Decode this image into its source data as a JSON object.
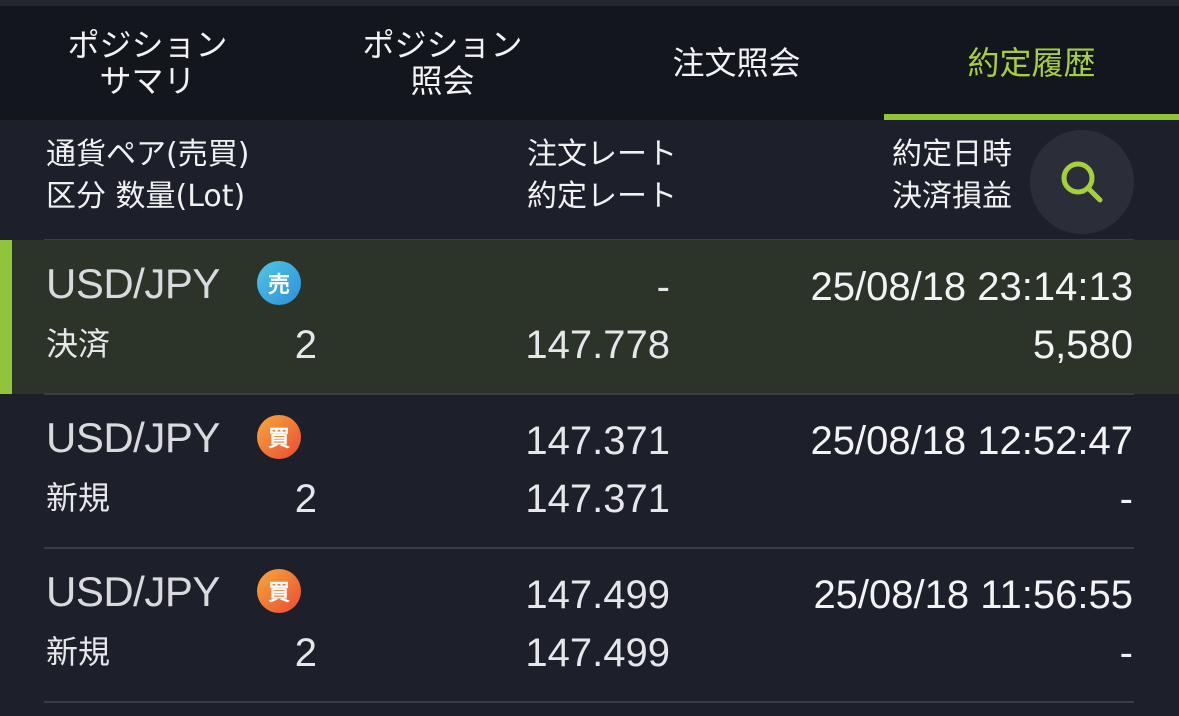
{
  "tabs": [
    {
      "label": "ポジション\nサマリ",
      "active": false
    },
    {
      "label": "ポジション\n照会",
      "active": false
    },
    {
      "label": "注文照会",
      "active": false
    },
    {
      "label": "約定履歴",
      "active": true
    }
  ],
  "header": {
    "col1_line1": "通貨ペア(売買)",
    "col1_line2": "区分  数量(Lot)",
    "col2_line1": "注文レート",
    "col2_line2": "約定レート",
    "col3_line1": "約定日時",
    "col3_line2": "決済損益",
    "search_icon": "search-icon"
  },
  "colors": {
    "accent": "#8fc43b",
    "active_tab": "#a5cf3d",
    "sell_badge": "#3aa8e0",
    "buy_badge": "#ef6b37",
    "background": "#1d202b"
  },
  "rows": [
    {
      "pair": "USD/JPY",
      "side": "売",
      "side_type": "sell",
      "category": "決済",
      "quantity": "2",
      "order_rate": "-",
      "exec_rate": "147.778",
      "datetime": "25/08/18 23:14:13",
      "pnl": "5,580",
      "selected": true
    },
    {
      "pair": "USD/JPY",
      "side": "買",
      "side_type": "buy",
      "category": "新規",
      "quantity": "2",
      "order_rate": "147.371",
      "exec_rate": "147.371",
      "datetime": "25/08/18 12:52:47",
      "pnl": "-",
      "selected": false
    },
    {
      "pair": "USD/JPY",
      "side": "買",
      "side_type": "buy",
      "category": "新規",
      "quantity": "2",
      "order_rate": "147.499",
      "exec_rate": "147.499",
      "datetime": "25/08/18 11:56:55",
      "pnl": "-",
      "selected": false
    }
  ]
}
